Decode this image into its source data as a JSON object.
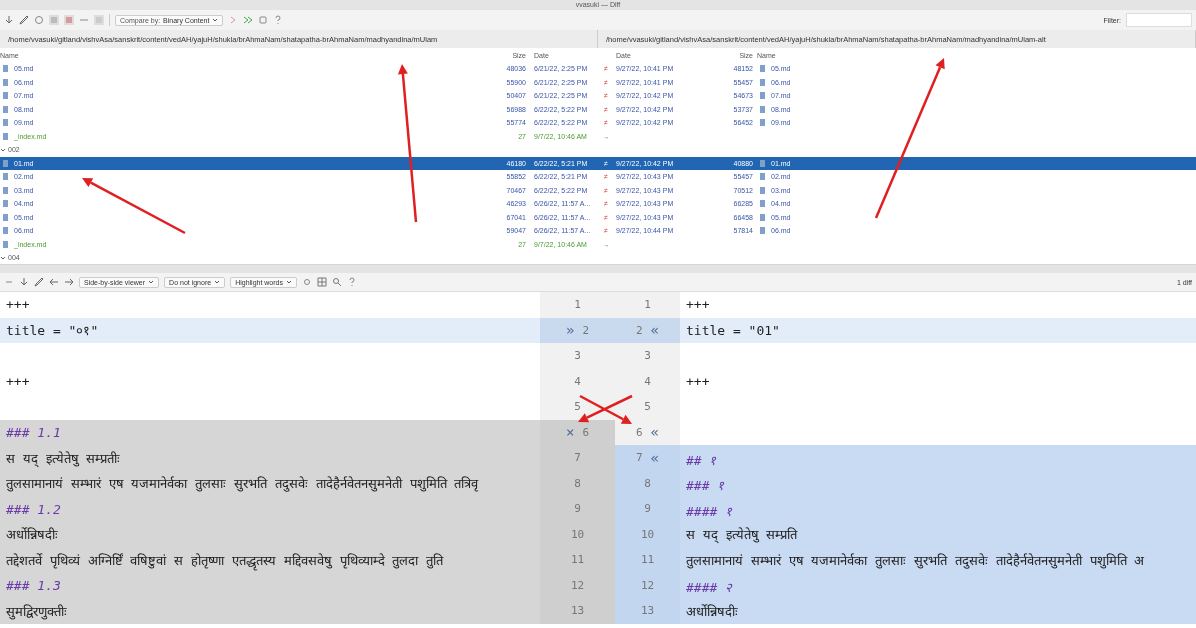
{
  "window": {
    "title": "vvasuki — Diff"
  },
  "toolbar": {
    "compare_label": "Compare by:",
    "compare_value": "Binary Content",
    "filter_label": "Filter:"
  },
  "left_path": "/home/vvasuki/gitland/vishvAsa/sanskrit/content/vedAH/yajuH/shukla/brAhmaNam/shatapatha-brAhmaNam/madhyandina/mUlam",
  "right_path": "/home/vvasuki/gitland/vishvAsa/sanskrit/content/vedAH/yajuH/shukla/brAhmaNam/shatapatha-brAhmaNam/madhyandina/mUlam-alt",
  "left_columns": [
    "Name",
    "Size",
    "Date"
  ],
  "right_columns": [
    "Date",
    "Size",
    "Name"
  ],
  "rows": [
    {
      "kind": "file",
      "name": "05.md",
      "left_size": "48036",
      "left_date": "6/21/22, 2:25 PM",
      "marker": "≠",
      "right_date": "9/27/22, 10:41 PM",
      "right_size": "48152",
      "right_name": "05.md",
      "selected": false
    },
    {
      "kind": "file",
      "name": "06.md",
      "left_size": "55900",
      "left_date": "6/21/22, 2:25 PM",
      "marker": "≠",
      "right_date": "9/27/22, 10:41 PM",
      "right_size": "55457",
      "right_name": "06.md",
      "selected": false
    },
    {
      "kind": "file",
      "name": "07.md",
      "left_size": "50407",
      "left_date": "6/21/22, 2:25 PM",
      "marker": "≠",
      "right_date": "9/27/22, 10:42 PM",
      "right_size": "54673",
      "right_name": "07.md",
      "selected": false
    },
    {
      "kind": "file",
      "name": "08.md",
      "left_size": "56988",
      "left_date": "6/22/22, 5:22 PM",
      "marker": "≠",
      "right_date": "9/27/22, 10:42 PM",
      "right_size": "53737",
      "right_name": "08.md",
      "selected": false
    },
    {
      "kind": "file",
      "name": "09.md",
      "left_size": "55774",
      "left_date": "6/22/22, 5:22 PM",
      "marker": "≠",
      "right_date": "9/27/22, 10:42 PM",
      "right_size": "56452",
      "right_name": "09.md",
      "selected": false
    },
    {
      "kind": "left_only",
      "name": "_index.md",
      "left_size": "27",
      "left_date": "9/7/22, 10:46 AM",
      "marker": "→",
      "selected": false
    },
    {
      "kind": "folder",
      "name": "002"
    },
    {
      "kind": "file",
      "name": "01.md",
      "left_size": "46180",
      "left_date": "6/22/22, 5:21 PM",
      "marker": "≠",
      "right_date": "9/27/22, 10:42 PM",
      "right_size": "40880",
      "right_name": "01.md",
      "selected": true
    },
    {
      "kind": "file",
      "name": "02.md",
      "left_size": "55852",
      "left_date": "6/22/22, 5:21 PM",
      "marker": "≠",
      "right_date": "9/27/22, 10:43 PM",
      "right_size": "55457",
      "right_name": "02.md",
      "selected": false
    },
    {
      "kind": "file",
      "name": "03.md",
      "left_size": "70467",
      "left_date": "6/22/22, 5:22 PM",
      "marker": "≠",
      "right_date": "9/27/22, 10:43 PM",
      "right_size": "70512",
      "right_name": "03.md",
      "selected": false
    },
    {
      "kind": "file",
      "name": "04.md",
      "left_size": "46293",
      "left_date": "6/26/22, 11:57 A...",
      "marker": "≠",
      "right_date": "9/27/22, 10:43 PM",
      "right_size": "66285",
      "right_name": "04.md",
      "selected": false
    },
    {
      "kind": "file",
      "name": "05.md",
      "left_size": "67041",
      "left_date": "6/26/22, 11:57 A...",
      "marker": "≠",
      "right_date": "9/27/22, 10:43 PM",
      "right_size": "66458",
      "right_name": "05.md",
      "selected": false
    },
    {
      "kind": "file",
      "name": "06.md",
      "left_size": "59047",
      "left_date": "6/26/22, 11:57 A...",
      "marker": "≠",
      "right_date": "9/27/22, 10:44 PM",
      "right_size": "57814",
      "right_name": "06.md",
      "selected": false
    },
    {
      "kind": "left_only",
      "name": "_index.md",
      "left_size": "27",
      "left_date": "9/7/22, 10:46 AM",
      "marker": "→",
      "selected": false
    },
    {
      "kind": "folder",
      "name": "004"
    }
  ],
  "diff_toolbar": {
    "viewer": "Side-by-side viewer",
    "ignore": "Do not ignore",
    "highlight": "Highlight words",
    "count": "1 diff"
  },
  "diff_lines": [
    {
      "left": {
        "kind": "plain",
        "no": "1",
        "text": "+++"
      },
      "right": {
        "kind": "plain",
        "no": "1",
        "text": "+++"
      }
    },
    {
      "left": {
        "kind": "changed",
        "no": "2",
        "text": "title = \"०१\"",
        "action": "»"
      },
      "right": {
        "kind": "changed",
        "no": "2",
        "text": "title = \"01\"",
        "action": "«"
      }
    },
    {
      "left": {
        "kind": "plain",
        "no": "3"
      },
      "right": {
        "kind": "plain",
        "no": "3"
      }
    },
    {
      "left": {
        "kind": "plain",
        "no": "4",
        "text": "+++"
      },
      "right": {
        "kind": "plain",
        "no": "4",
        "text": "+++"
      }
    },
    {
      "left": {
        "kind": "plain",
        "no": "5"
      },
      "right": {
        "kind": "plain",
        "no": "5"
      }
    },
    {
      "left": {
        "kind": "deleted",
        "no": "6",
        "text": "### 1.1",
        "heading": true,
        "action": "×"
      },
      "right": {
        "kind": "plain",
        "no": "6",
        "action": "«"
      }
    },
    {
      "left": {
        "kind": "deleted",
        "no": "7",
        "text": "स यद्‌ इत्येतेषु सम्प्रतीः"
      },
      "right": {
        "kind": "inserted",
        "no": "7",
        "text": "## १",
        "heading": true,
        "action": "«"
      }
    },
    {
      "left": {
        "kind": "deleted",
        "no": "8",
        "text": "तुलसामानायं सम्भारं एष यजमानेर्वका तुलसाः सुरभति तदुसवेः तादेहैर्नवेतनसुमनेती पशुमिति तत्रिवृ"
      },
      "right": {
        "kind": "inserted",
        "no": "8",
        "text": "### १",
        "heading": true
      }
    },
    {
      "left": {
        "kind": "deleted",
        "no": "9",
        "text": "### 1.2",
        "heading": true
      },
      "right": {
        "kind": "inserted",
        "no": "9",
        "text": "#### १",
        "heading": true
      }
    },
    {
      "left": {
        "kind": "deleted",
        "no": "10",
        "text": "अर्धोन्निषदीः"
      },
      "right": {
        "kind": "inserted",
        "no": "10",
        "text": "स यद्‌ इत्येतेषु सम्प्रति"
      }
    },
    {
      "left": {
        "kind": "deleted",
        "no": "11",
        "text": "तद्देशतर्वे पृथिव्यं अग्निर्ष्टिं वषिष्टुवां स होतृष्णा एतद्धृतस्य मद्दिवसवेषु पृथिव्याम्दे तुलदा तुति"
      },
      "right": {
        "kind": "inserted",
        "no": "11",
        "text": "तुलसामानायं सम्भारं एष यजमानेर्वका तुलसाः सुरभति तदुसवेः तादेहैर्नवेतनसुमनेती पशुमिति अ"
      }
    },
    {
      "left": {
        "kind": "deleted",
        "no": "12",
        "text": "### 1.3",
        "heading": true
      },
      "right": {
        "kind": "inserted",
        "no": "12",
        "text": "#### २",
        "heading": true
      }
    },
    {
      "left": {
        "kind": "deleted",
        "no": "13",
        "text": "सुमद्विरणुक्तीः"
      },
      "right": {
        "kind": "inserted",
        "no": "13",
        "text": "अर्धोन्निषदीः"
      }
    }
  ]
}
